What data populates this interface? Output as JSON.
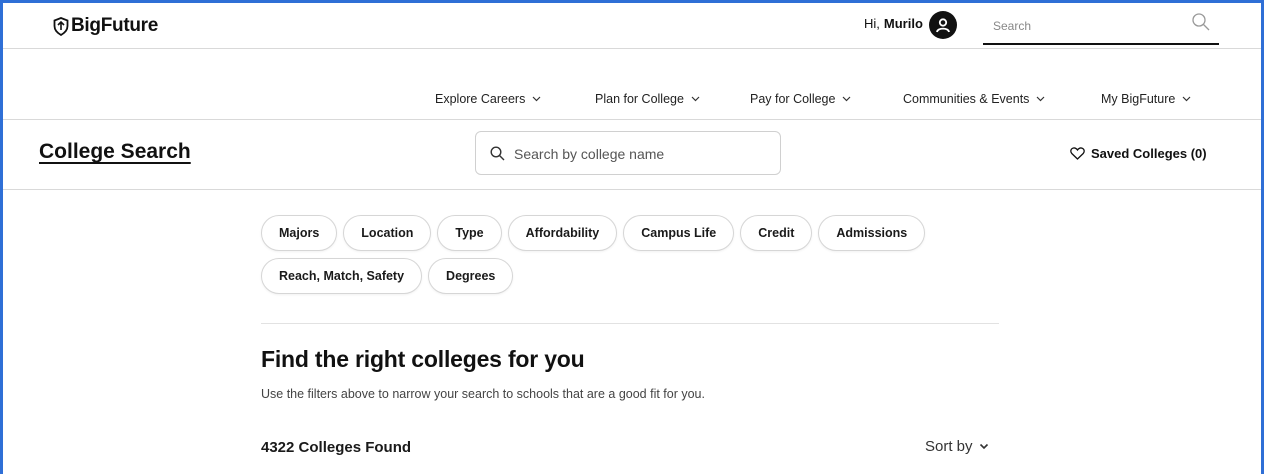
{
  "header": {
    "logo_text": "BigFuture",
    "greeting_prefix": "Hi,",
    "user_name": "Murilo",
    "search_placeholder": "Search"
  },
  "nav": {
    "items": [
      {
        "label": "Explore Careers"
      },
      {
        "label": "Plan for College"
      },
      {
        "label": "Pay for College"
      },
      {
        "label": "Communities & Events"
      },
      {
        "label": "My BigFuture"
      }
    ]
  },
  "search_bar": {
    "page_title": "College Search",
    "college_search_placeholder": "Search by college name",
    "saved_colleges_label": "Saved Colleges (0)"
  },
  "filters": {
    "row1": [
      "Majors",
      "Location",
      "Type",
      "Affordability",
      "Campus Life",
      "Credit",
      "Admissions"
    ],
    "row2": [
      "Reach, Match, Safety",
      "Degrees"
    ]
  },
  "results": {
    "heading": "Find the right colleges for you",
    "subtext": "Use the filters above to narrow your search to schools that are a good fit for you.",
    "count_label": "4322 Colleges Found",
    "sort_label": "Sort by"
  },
  "colors": {
    "frame_border": "#2f6fd6",
    "text": "#1e1e1e",
    "divider": "#d9d9d9"
  },
  "icons": [
    "shield-logo-icon",
    "user-avatar-icon",
    "search-icon",
    "chevron-down-icon",
    "heart-icon"
  ]
}
